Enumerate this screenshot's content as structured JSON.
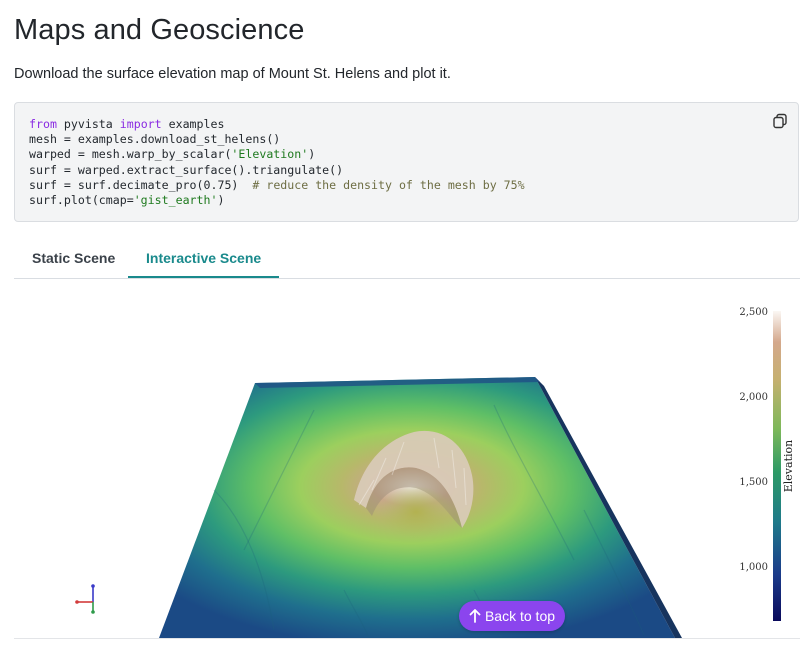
{
  "page": {
    "title": "Maps and Geoscience",
    "intro": "Download the surface elevation map of Mount St. Helens and plot it."
  },
  "code": {
    "lines": [
      {
        "kw": "from",
        "a": " pyvista ",
        "kw2": "import",
        "b": " examples"
      },
      {
        "text": "mesh = examples.download_st_helens()"
      },
      {
        "pre": "warped = mesh.warp_by_scalar(",
        "str": "'Elevation'",
        "post": ")"
      },
      {
        "text": "surf = warped.extract_surface().triangulate()"
      },
      {
        "pre": "surf = surf.decimate_pro(0.75)  ",
        "cmt": "# reduce the density of the mesh by 75%"
      },
      {
        "pre": "surf.plot(cmap=",
        "str": "'gist_earth'",
        "post": ")"
      }
    ],
    "copy_icon": "copy-icon"
  },
  "tabs": [
    {
      "label": "Static Scene",
      "active": false
    },
    {
      "label": "Interactive Scene",
      "active": true
    }
  ],
  "accent_color": "#1a8a8c",
  "colorbar": {
    "title": "Elevation",
    "ticks": [
      "2,500",
      "2,000",
      "1,500",
      "1,000"
    ],
    "colormap": "gist_earth"
  },
  "back_to_top": {
    "label": "Back to top",
    "icon": "arrow-up-icon",
    "color": "#8b45ee"
  }
}
